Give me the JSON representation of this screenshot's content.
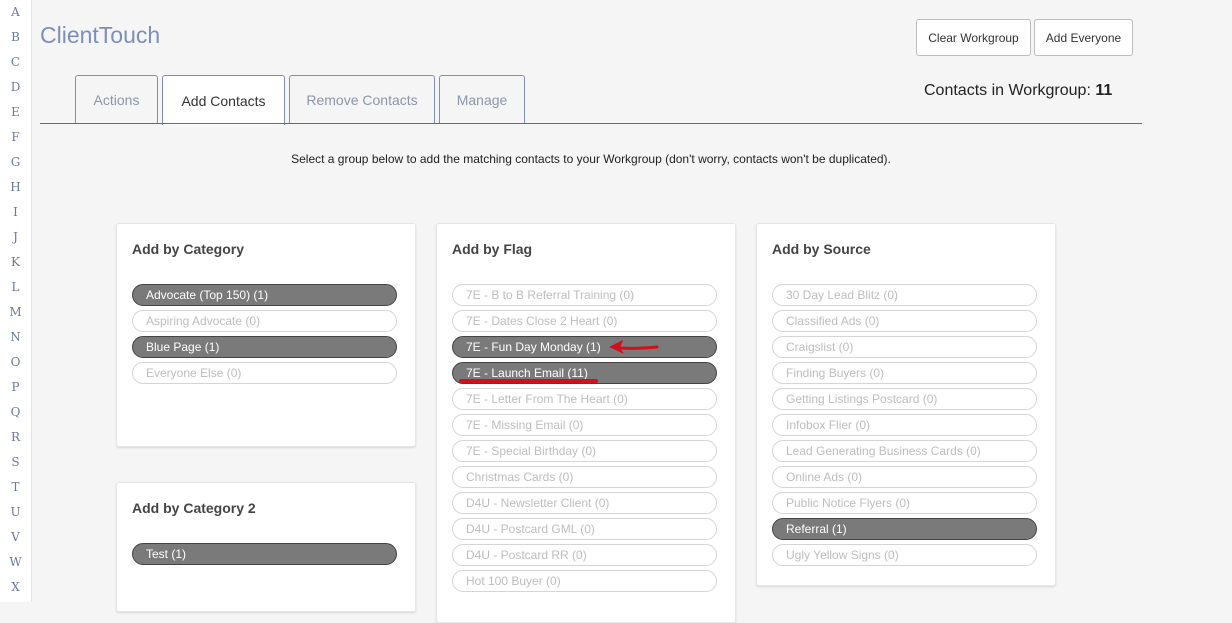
{
  "alphabet": [
    "A",
    "B",
    "C",
    "D",
    "E",
    "F",
    "G",
    "H",
    "I",
    "J",
    "K",
    "L",
    "M",
    "N",
    "O",
    "P",
    "Q",
    "R",
    "S",
    "T",
    "U",
    "V",
    "W",
    "X"
  ],
  "app": {
    "title": "ClientTouch"
  },
  "header_buttons": {
    "clear": "Clear Workgroup",
    "add_everyone": "Add Everyone"
  },
  "tabs": [
    {
      "label": "Actions",
      "active": false
    },
    {
      "label": "Add Contacts",
      "active": true
    },
    {
      "label": "Remove Contacts",
      "active": false
    },
    {
      "label": "Manage",
      "active": false
    }
  ],
  "workgroup": {
    "label": "Contacts in Workgroup:",
    "count": "11"
  },
  "instructions": "Select a group below to add the matching contacts to your Workgroup (don't worry, contacts won't be duplicated).",
  "panels": {
    "category": {
      "title": "Add by Category",
      "items": [
        {
          "label": "Advocate (Top 150) (1)",
          "selected": true
        },
        {
          "label": "Aspiring Advocate (0)",
          "selected": false
        },
        {
          "label": "Blue Page (1)",
          "selected": true
        },
        {
          "label": "Everyone Else (0)",
          "selected": false
        }
      ]
    },
    "category2": {
      "title": "Add by Category 2",
      "items": [
        {
          "label": "Test (1)",
          "selected": true
        }
      ]
    },
    "flag": {
      "title": "Add by Flag",
      "items": [
        {
          "label": "7E - B to B Referral Training (0)",
          "selected": false
        },
        {
          "label": "7E - Dates Close 2 Heart (0)",
          "selected": false
        },
        {
          "label": "7E - Fun Day Monday (1)",
          "selected": true
        },
        {
          "label": "7E - Launch Email (11)",
          "selected": true
        },
        {
          "label": "7E - Letter From The Heart (0)",
          "selected": false
        },
        {
          "label": "7E - Missing Email (0)",
          "selected": false
        },
        {
          "label": "7E - Special Birthday (0)",
          "selected": false
        },
        {
          "label": "Christmas Cards (0)",
          "selected": false
        },
        {
          "label": "D4U - Newsletter Client (0)",
          "selected": false
        },
        {
          "label": "D4U - Postcard GML (0)",
          "selected": false
        },
        {
          "label": "D4U - Postcard RR (0)",
          "selected": false
        },
        {
          "label": "Hot 100 Buyer (0)",
          "selected": false
        }
      ]
    },
    "source": {
      "title": "Add by Source",
      "items": [
        {
          "label": "30 Day Lead Blitz (0)",
          "selected": false
        },
        {
          "label": "Classified Ads (0)",
          "selected": false
        },
        {
          "label": "Craigslist (0)",
          "selected": false
        },
        {
          "label": "Finding Buyers (0)",
          "selected": false
        },
        {
          "label": "Getting Listings Postcard (0)",
          "selected": false
        },
        {
          "label": "Infobox Flier (0)",
          "selected": false
        },
        {
          "label": "Lead Generating Business Cards (0)",
          "selected": false
        },
        {
          "label": "Online Ads (0)",
          "selected": false
        },
        {
          "label": "Public Notice Flyers (0)",
          "selected": false
        },
        {
          "label": "Referral (1)",
          "selected": true
        },
        {
          "label": "Ugly Yellow Signs (0)",
          "selected": false
        }
      ]
    }
  },
  "colors": {
    "brand": "#7d8fb9",
    "selected_pill": "#7a7a7a",
    "annotation": "#d0101a"
  }
}
